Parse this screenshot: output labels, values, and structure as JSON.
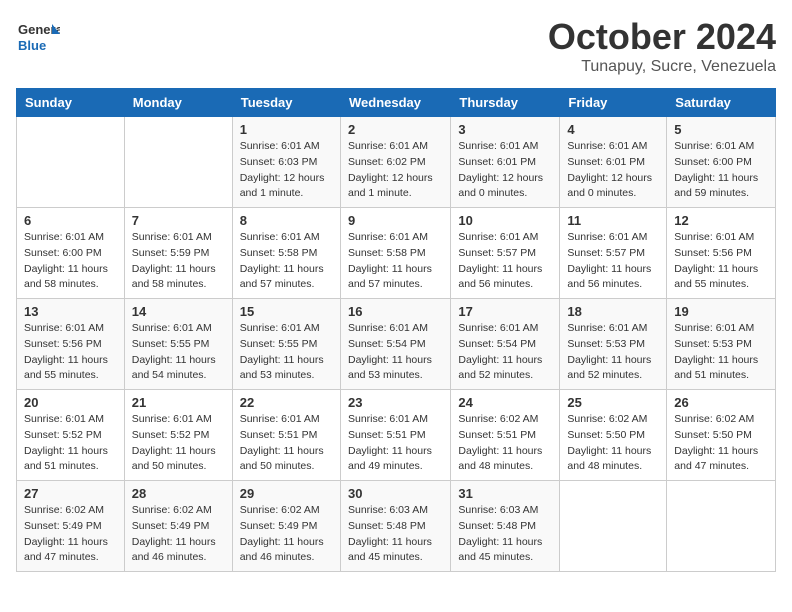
{
  "header": {
    "logo_line1": "General",
    "logo_line2": "Blue",
    "month": "October 2024",
    "location": "Tunapuy, Sucre, Venezuela"
  },
  "days_of_week": [
    "Sunday",
    "Monday",
    "Tuesday",
    "Wednesday",
    "Thursday",
    "Friday",
    "Saturday"
  ],
  "weeks": [
    [
      {
        "num": "",
        "sunrise": "",
        "sunset": "",
        "daylight": ""
      },
      {
        "num": "",
        "sunrise": "",
        "sunset": "",
        "daylight": ""
      },
      {
        "num": "1",
        "sunrise": "Sunrise: 6:01 AM",
        "sunset": "Sunset: 6:03 PM",
        "daylight": "Daylight: 12 hours and 1 minute."
      },
      {
        "num": "2",
        "sunrise": "Sunrise: 6:01 AM",
        "sunset": "Sunset: 6:02 PM",
        "daylight": "Daylight: 12 hours and 1 minute."
      },
      {
        "num": "3",
        "sunrise": "Sunrise: 6:01 AM",
        "sunset": "Sunset: 6:01 PM",
        "daylight": "Daylight: 12 hours and 0 minutes."
      },
      {
        "num": "4",
        "sunrise": "Sunrise: 6:01 AM",
        "sunset": "Sunset: 6:01 PM",
        "daylight": "Daylight: 12 hours and 0 minutes."
      },
      {
        "num": "5",
        "sunrise": "Sunrise: 6:01 AM",
        "sunset": "Sunset: 6:00 PM",
        "daylight": "Daylight: 11 hours and 59 minutes."
      }
    ],
    [
      {
        "num": "6",
        "sunrise": "Sunrise: 6:01 AM",
        "sunset": "Sunset: 6:00 PM",
        "daylight": "Daylight: 11 hours and 58 minutes."
      },
      {
        "num": "7",
        "sunrise": "Sunrise: 6:01 AM",
        "sunset": "Sunset: 5:59 PM",
        "daylight": "Daylight: 11 hours and 58 minutes."
      },
      {
        "num": "8",
        "sunrise": "Sunrise: 6:01 AM",
        "sunset": "Sunset: 5:58 PM",
        "daylight": "Daylight: 11 hours and 57 minutes."
      },
      {
        "num": "9",
        "sunrise": "Sunrise: 6:01 AM",
        "sunset": "Sunset: 5:58 PM",
        "daylight": "Daylight: 11 hours and 57 minutes."
      },
      {
        "num": "10",
        "sunrise": "Sunrise: 6:01 AM",
        "sunset": "Sunset: 5:57 PM",
        "daylight": "Daylight: 11 hours and 56 minutes."
      },
      {
        "num": "11",
        "sunrise": "Sunrise: 6:01 AM",
        "sunset": "Sunset: 5:57 PM",
        "daylight": "Daylight: 11 hours and 56 minutes."
      },
      {
        "num": "12",
        "sunrise": "Sunrise: 6:01 AM",
        "sunset": "Sunset: 5:56 PM",
        "daylight": "Daylight: 11 hours and 55 minutes."
      }
    ],
    [
      {
        "num": "13",
        "sunrise": "Sunrise: 6:01 AM",
        "sunset": "Sunset: 5:56 PM",
        "daylight": "Daylight: 11 hours and 55 minutes."
      },
      {
        "num": "14",
        "sunrise": "Sunrise: 6:01 AM",
        "sunset": "Sunset: 5:55 PM",
        "daylight": "Daylight: 11 hours and 54 minutes."
      },
      {
        "num": "15",
        "sunrise": "Sunrise: 6:01 AM",
        "sunset": "Sunset: 5:55 PM",
        "daylight": "Daylight: 11 hours and 53 minutes."
      },
      {
        "num": "16",
        "sunrise": "Sunrise: 6:01 AM",
        "sunset": "Sunset: 5:54 PM",
        "daylight": "Daylight: 11 hours and 53 minutes."
      },
      {
        "num": "17",
        "sunrise": "Sunrise: 6:01 AM",
        "sunset": "Sunset: 5:54 PM",
        "daylight": "Daylight: 11 hours and 52 minutes."
      },
      {
        "num": "18",
        "sunrise": "Sunrise: 6:01 AM",
        "sunset": "Sunset: 5:53 PM",
        "daylight": "Daylight: 11 hours and 52 minutes."
      },
      {
        "num": "19",
        "sunrise": "Sunrise: 6:01 AM",
        "sunset": "Sunset: 5:53 PM",
        "daylight": "Daylight: 11 hours and 51 minutes."
      }
    ],
    [
      {
        "num": "20",
        "sunrise": "Sunrise: 6:01 AM",
        "sunset": "Sunset: 5:52 PM",
        "daylight": "Daylight: 11 hours and 51 minutes."
      },
      {
        "num": "21",
        "sunrise": "Sunrise: 6:01 AM",
        "sunset": "Sunset: 5:52 PM",
        "daylight": "Daylight: 11 hours and 50 minutes."
      },
      {
        "num": "22",
        "sunrise": "Sunrise: 6:01 AM",
        "sunset": "Sunset: 5:51 PM",
        "daylight": "Daylight: 11 hours and 50 minutes."
      },
      {
        "num": "23",
        "sunrise": "Sunrise: 6:01 AM",
        "sunset": "Sunset: 5:51 PM",
        "daylight": "Daylight: 11 hours and 49 minutes."
      },
      {
        "num": "24",
        "sunrise": "Sunrise: 6:02 AM",
        "sunset": "Sunset: 5:51 PM",
        "daylight": "Daylight: 11 hours and 48 minutes."
      },
      {
        "num": "25",
        "sunrise": "Sunrise: 6:02 AM",
        "sunset": "Sunset: 5:50 PM",
        "daylight": "Daylight: 11 hours and 48 minutes."
      },
      {
        "num": "26",
        "sunrise": "Sunrise: 6:02 AM",
        "sunset": "Sunset: 5:50 PM",
        "daylight": "Daylight: 11 hours and 47 minutes."
      }
    ],
    [
      {
        "num": "27",
        "sunrise": "Sunrise: 6:02 AM",
        "sunset": "Sunset: 5:49 PM",
        "daylight": "Daylight: 11 hours and 47 minutes."
      },
      {
        "num": "28",
        "sunrise": "Sunrise: 6:02 AM",
        "sunset": "Sunset: 5:49 PM",
        "daylight": "Daylight: 11 hours and 46 minutes."
      },
      {
        "num": "29",
        "sunrise": "Sunrise: 6:02 AM",
        "sunset": "Sunset: 5:49 PM",
        "daylight": "Daylight: 11 hours and 46 minutes."
      },
      {
        "num": "30",
        "sunrise": "Sunrise: 6:03 AM",
        "sunset": "Sunset: 5:48 PM",
        "daylight": "Daylight: 11 hours and 45 minutes."
      },
      {
        "num": "31",
        "sunrise": "Sunrise: 6:03 AM",
        "sunset": "Sunset: 5:48 PM",
        "daylight": "Daylight: 11 hours and 45 minutes."
      },
      {
        "num": "",
        "sunrise": "",
        "sunset": "",
        "daylight": ""
      },
      {
        "num": "",
        "sunrise": "",
        "sunset": "",
        "daylight": ""
      }
    ]
  ]
}
